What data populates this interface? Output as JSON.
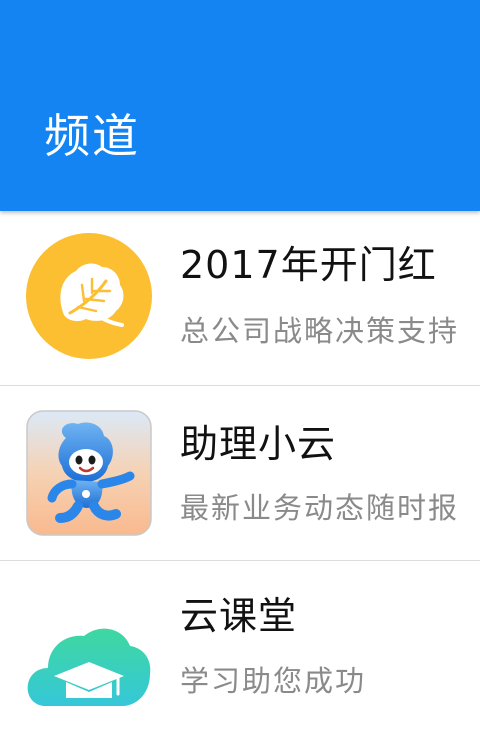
{
  "header": {
    "title": "频道",
    "background_color": "#1384f2"
  },
  "channels": [
    {
      "title": "2017年开门红",
      "subtitle": "总公司战略决策支持",
      "icon": "leaf-icon",
      "icon_color": "#fcbf32"
    },
    {
      "title": "助理小云",
      "subtitle": "最新业务动态随时报",
      "icon": "mascot-icon",
      "icon_color": "#2a86e8"
    },
    {
      "title": "云课堂",
      "subtitle": "学习助您成功",
      "icon": "cloud-graduation-cap-icon",
      "icon_color": "#2fd3a4"
    }
  ]
}
